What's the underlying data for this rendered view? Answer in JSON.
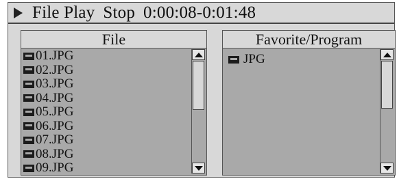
{
  "title_bar": {
    "icon": "play-icon",
    "mode": "File Play",
    "status": "Stop",
    "time": "0:00:08-0:01:48"
  },
  "file_panel": {
    "header": "File",
    "items": [
      {
        "icon": "folder-icon",
        "label": "01.JPG"
      },
      {
        "icon": "folder-icon",
        "label": "02.JPG"
      },
      {
        "icon": "folder-icon",
        "label": "03.JPG"
      },
      {
        "icon": "folder-icon",
        "label": "04.JPG"
      },
      {
        "icon": "folder-icon",
        "label": "05.JPG"
      },
      {
        "icon": "folder-icon",
        "label": "06.JPG"
      },
      {
        "icon": "folder-icon",
        "label": "07.JPG"
      },
      {
        "icon": "folder-icon",
        "label": "08.JPG"
      },
      {
        "icon": "folder-icon",
        "label": "09.JPG"
      }
    ]
  },
  "favorite_panel": {
    "header": "Favorite/Program",
    "items": [
      {
        "icon": "folder-icon",
        "label": "JPG"
      }
    ]
  },
  "colors": {
    "background": "#d8d8d8",
    "list_background": "#a9a9a9",
    "border": "#555555"
  }
}
